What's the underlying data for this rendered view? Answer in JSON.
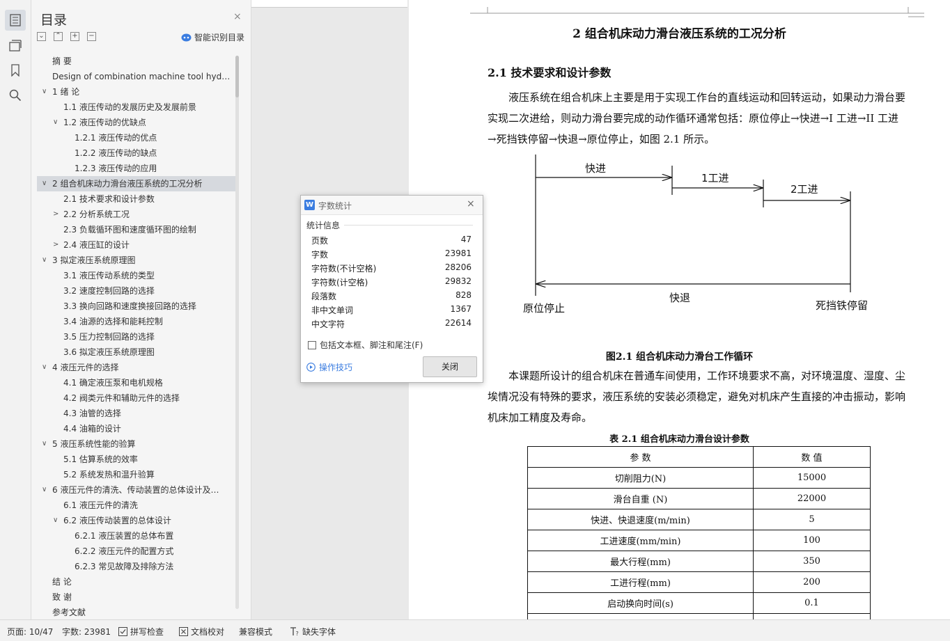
{
  "toc": {
    "title": "目录",
    "close": "×",
    "toolbar": [
      "⌄",
      "⌃",
      "+",
      "−"
    ],
    "smart_label": "智能识别目录",
    "items": [
      {
        "text": "摘  要",
        "level": 0,
        "arrow": ""
      },
      {
        "text": "Design of combination machine tool hydr…",
        "level": 0,
        "arrow": ""
      },
      {
        "text": "1   绪  论",
        "level": 0,
        "arrow": "v"
      },
      {
        "text": "1.1  液压传动的发展历史及发展前景",
        "level": 1,
        "arrow": ""
      },
      {
        "text": "1.2  液压传动的优缺点",
        "level": 1,
        "arrow": "v"
      },
      {
        "text": "1.2.1  液压传动的优点",
        "level": 2,
        "arrow": ""
      },
      {
        "text": "1.2.2  液压传动的缺点",
        "level": 2,
        "arrow": ""
      },
      {
        "text": "1.2.3  液压传动的应用",
        "level": 2,
        "arrow": ""
      },
      {
        "text": "2   组合机床动力滑台液压系统的工况分析",
        "level": 0,
        "arrow": "v",
        "selected": true
      },
      {
        "text": "2.1  技术要求和设计参数",
        "level": 1,
        "arrow": ""
      },
      {
        "text": "2.2  分析系统工况",
        "level": 1,
        "arrow": ">"
      },
      {
        "text": "2.3  负载循环图和速度循环图的绘制",
        "level": 1,
        "arrow": ""
      },
      {
        "text": "2.4  液压缸的设计",
        "level": 1,
        "arrow": ">"
      },
      {
        "text": "3   拟定液压系统原理图",
        "level": 0,
        "arrow": "v"
      },
      {
        "text": "3.1  液压传动系统的类型",
        "level": 1,
        "arrow": ""
      },
      {
        "text": "3.2  速度控制回路的选择",
        "level": 1,
        "arrow": ""
      },
      {
        "text": "3.3  换向回路和速度换接回路的选择",
        "level": 1,
        "arrow": ""
      },
      {
        "text": "3.4  油源的选择和能耗控制",
        "level": 1,
        "arrow": ""
      },
      {
        "text": "3.5  压力控制回路的选择",
        "level": 1,
        "arrow": ""
      },
      {
        "text": "3.6  拟定液压系统原理图",
        "level": 1,
        "arrow": ""
      },
      {
        "text": "4   液压元件的选择",
        "level": 0,
        "arrow": "v"
      },
      {
        "text": "4.1  确定液压泵和电机规格",
        "level": 1,
        "arrow": ""
      },
      {
        "text": "4.2  阀类元件和辅助元件的选择",
        "level": 1,
        "arrow": ""
      },
      {
        "text": "4.3  油管的选择",
        "level": 1,
        "arrow": ""
      },
      {
        "text": "4.4  油箱的设计",
        "level": 1,
        "arrow": ""
      },
      {
        "text": "5   液压系统性能的验算",
        "level": 0,
        "arrow": "v"
      },
      {
        "text": "5.1  估算系统的效率",
        "level": 1,
        "arrow": ""
      },
      {
        "text": "5.2  系统发热和温升验算",
        "level": 1,
        "arrow": ""
      },
      {
        "text": "6   液压元件的清洗、传动装置的总体设计及…",
        "level": 0,
        "arrow": "v"
      },
      {
        "text": "6.1  液压元件的清洗",
        "level": 1,
        "arrow": ""
      },
      {
        "text": "6.2  液压传动装置的总体设计",
        "level": 1,
        "arrow": "v"
      },
      {
        "text": "6.2.1  液压装置的总体布置",
        "level": 2,
        "arrow": ""
      },
      {
        "text": "6.2.2  液压元件的配置方式",
        "level": 2,
        "arrow": ""
      },
      {
        "text": "6.2.3  常见故障及排除方法",
        "level": 2,
        "arrow": ""
      },
      {
        "text": "结  论",
        "level": 0,
        "arrow": ""
      },
      {
        "text": "致  谢",
        "level": 0,
        "arrow": ""
      },
      {
        "text": "参考文献",
        "level": 0,
        "arrow": ""
      }
    ]
  },
  "doc": {
    "chapter_title": "2   组合机床动力滑台液压系统的工况分析",
    "section_title": "2.1  技术要求和设计参数",
    "para1": "液压系统在组合机床上主要是用于实现工作台的直线运动和回转运动，如果动力滑台要实现二次进给，则动力滑台要完成的动作循环通常包括：原位停止→快进→I 工进→II 工进→死挡铁停留→快退→原位停止，如图 2.1 所示。",
    "figure": {
      "label_fast_in": "快进",
      "label_feed1": "1工进",
      "label_feed2": "2工进",
      "label_fast_back": "快退",
      "label_origin": "原位停止",
      "label_dwell": "死挡铁停留"
    },
    "figure_caption": "图2.1  组合机床动力滑台工作循环",
    "para2": "本课题所设计的组合机床在普通车间使用，工作环境要求不高，对环境温度、湿度、尘埃情况没有特殊的要求，液压系统的安装必须稳定，避免对机床产生直接的冲击振动，影响机床加工精度及寿命。",
    "table_caption": "表 2.1  组合机床动力滑台设计参数",
    "table": {
      "headers": [
        "参    数",
        "数    值"
      ],
      "rows": [
        [
          "切削阻力(N)",
          "15000"
        ],
        [
          "滑台自重 (N)",
          "22000"
        ],
        [
          "快进、快退速度(m/min)",
          "5"
        ],
        [
          "工进速度(mm/min)",
          "100"
        ],
        [
          "最大行程(mm)",
          "350"
        ],
        [
          "工进行程(mm)",
          "200"
        ],
        [
          "启动换向时间(s)",
          "0.1"
        ]
      ]
    }
  },
  "dialog": {
    "logo": "W",
    "title": "字数统计",
    "close": "×",
    "group_label": "统计信息",
    "stats": [
      {
        "label": "页数",
        "value": "47"
      },
      {
        "label": "字数",
        "value": "23981"
      },
      {
        "label": "字符数(不计空格)",
        "value": "28206"
      },
      {
        "label": "字符数(计空格)",
        "value": "29832"
      },
      {
        "label": "段落数",
        "value": "828"
      },
      {
        "label": "非中文单词",
        "value": "1367"
      },
      {
        "label": "中文字符",
        "value": "22614"
      }
    ],
    "checkbox_label": "包括文本框、脚注和尾注(F)",
    "tips_label": "操作技巧",
    "close_button": "关闭"
  },
  "status": {
    "page": "页面: 10/47",
    "words": "字数: 23981",
    "spell": "拼写检查",
    "proof": "文档校对",
    "compat": "兼容模式",
    "missing_font": "缺失字体"
  },
  "colors": {
    "accent": "#3b7de0",
    "selected_row": "#d6d9de"
  }
}
